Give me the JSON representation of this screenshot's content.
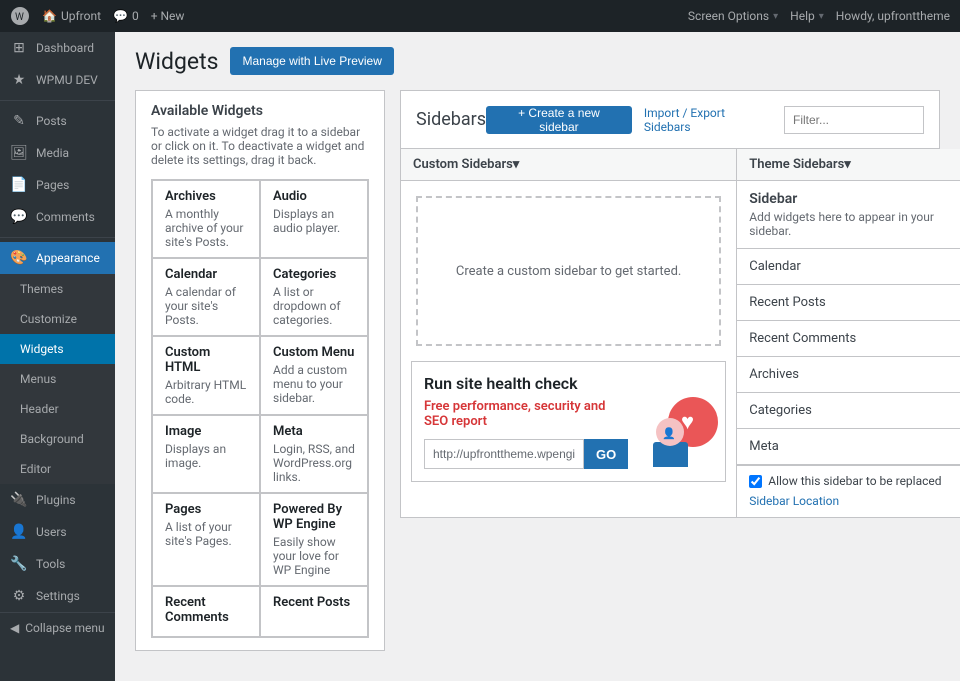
{
  "adminbar": {
    "site_name": "Upfront",
    "comments_count": "0",
    "new_label": "+ New",
    "howdy": "Howdy, upfronttheme",
    "screen_options": "Screen Options",
    "help": "Help"
  },
  "sidebar": {
    "items": [
      {
        "id": "dashboard",
        "label": "Dashboard",
        "icon": "⊞"
      },
      {
        "id": "wpmu-dev",
        "label": "WPMU DEV",
        "icon": "★"
      },
      {
        "id": "posts",
        "label": "Posts",
        "icon": "✎"
      },
      {
        "id": "media",
        "label": "Media",
        "icon": "🖼"
      },
      {
        "id": "pages",
        "label": "Pages",
        "icon": "📄"
      },
      {
        "id": "comments",
        "label": "Comments",
        "icon": "💬"
      }
    ],
    "appearance_label": "Appearance",
    "appearance_sub": [
      {
        "id": "themes",
        "label": "Themes"
      },
      {
        "id": "customize",
        "label": "Customize"
      },
      {
        "id": "widgets",
        "label": "Widgets"
      },
      {
        "id": "menus",
        "label": "Menus"
      },
      {
        "id": "header",
        "label": "Header"
      },
      {
        "id": "background",
        "label": "Background"
      },
      {
        "id": "editor",
        "label": "Editor"
      }
    ],
    "more_items": [
      {
        "id": "plugins",
        "label": "Plugins",
        "icon": "🔌"
      },
      {
        "id": "users",
        "label": "Users",
        "icon": "👤"
      },
      {
        "id": "tools",
        "label": "Tools",
        "icon": "🔧"
      },
      {
        "id": "settings",
        "label": "Settings",
        "icon": "⚙"
      }
    ],
    "collapse_label": "Collapse menu"
  },
  "page": {
    "title": "Widgets",
    "manage_btn": "Manage with Live Preview"
  },
  "available_widgets": {
    "title": "Available Widgets",
    "description": "To activate a widget drag it to a sidebar or click on it. To deactivate a widget and delete its settings, drag it back.",
    "widgets": [
      {
        "name": "Archives",
        "desc": "A monthly archive of your site's Posts."
      },
      {
        "name": "Audio",
        "desc": "Displays an audio player."
      },
      {
        "name": "Calendar",
        "desc": "A calendar of your site's Posts."
      },
      {
        "name": "Categories",
        "desc": "A list or dropdown of categories."
      },
      {
        "name": "Custom HTML",
        "desc": "Arbitrary HTML code."
      },
      {
        "name": "Custom Menu",
        "desc": "Add a custom menu to your sidebar."
      },
      {
        "name": "Image",
        "desc": "Displays an image."
      },
      {
        "name": "Meta",
        "desc": "Login, RSS, and WordPress.org links."
      },
      {
        "name": "Pages",
        "desc": "A list of your site's Pages."
      },
      {
        "name": "Powered By WP Engine",
        "desc": "Easily show your love for WP Engine"
      },
      {
        "name": "Recent Comments",
        "desc": ""
      },
      {
        "name": "Recent Posts",
        "desc": ""
      }
    ]
  },
  "sidebars": {
    "title": "Sidebars",
    "create_btn": "+ Create a new sidebar",
    "import_export": "Import / Export Sidebars",
    "filter_placeholder": "Filter...",
    "custom_section_title": "Custom Sidebars▾",
    "custom_empty_text": "Create a custom sidebar to get started.",
    "theme_section_title": "Theme Sidebars▾",
    "theme_sidebar": {
      "name": "Sidebar",
      "desc": "Add widgets here to appear in your sidebar.",
      "widgets": [
        {
          "name": "Calendar"
        },
        {
          "name": "Recent Posts"
        },
        {
          "name": "Recent Comments"
        },
        {
          "name": "Archives"
        },
        {
          "name": "Categories"
        },
        {
          "name": "Meta"
        }
      ],
      "allow_replace_label": "Allow this sidebar to be replaced",
      "sidebar_location": "Sidebar Location"
    }
  },
  "health_check": {
    "title": "Run site health check",
    "subtitle": "Free performance, security and SEO report",
    "url_value": "http://upfronttheme.wpengine",
    "go_btn": "GO"
  }
}
